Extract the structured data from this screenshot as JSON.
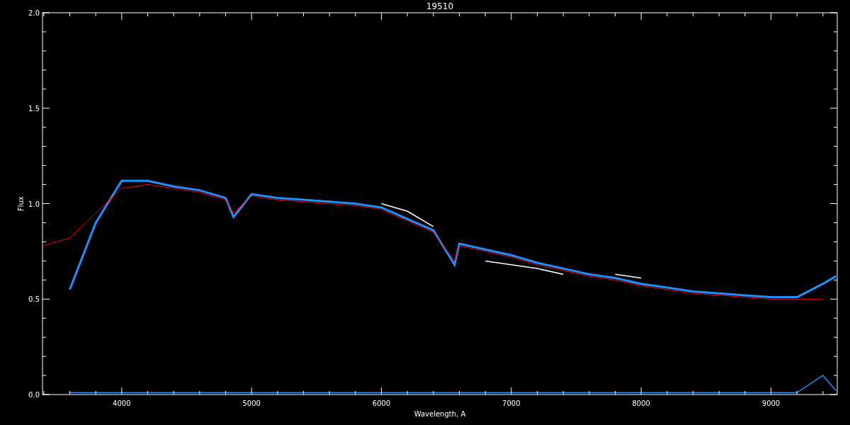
{
  "plot": {
    "chart_data": {
      "type": "line",
      "title": "19510",
      "xlabel": "Wavelength, A",
      "ylabel": "Flux",
      "x": [
        3400,
        3600,
        3800,
        4000,
        4200,
        4400,
        4600,
        4800,
        4861,
        5000,
        5200,
        5400,
        5600,
        5800,
        6000,
        6200,
        6400,
        6563,
        6600,
        6800,
        7000,
        7200,
        7400,
        7600,
        7800,
        8000,
        8200,
        8400,
        8600,
        8800,
        9000,
        9200,
        9400,
        9500
      ],
      "series": [
        {
          "color": "#ffffff",
          "values": [
            null,
            null,
            null,
            null,
            null,
            null,
            null,
            null,
            null,
            null,
            null,
            null,
            null,
            null,
            1.0,
            0.96,
            0.88,
            null,
            null,
            0.7,
            0.68,
            0.66,
            0.63,
            null,
            0.63,
            0.61,
            null,
            null,
            null,
            null,
            null,
            null,
            null,
            null
          ]
        },
        {
          "color": "#1e90ff",
          "values": [
            null,
            0.55,
            0.9,
            1.12,
            1.12,
            1.09,
            1.07,
            1.03,
            0.93,
            1.05,
            1.03,
            1.02,
            1.01,
            1.0,
            0.98,
            0.92,
            0.86,
            0.68,
            0.79,
            0.76,
            0.73,
            0.69,
            0.66,
            0.63,
            0.61,
            0.58,
            0.56,
            0.54,
            0.53,
            0.52,
            0.51,
            0.51,
            0.58,
            0.62
          ]
        },
        {
          "color": "#ff0000",
          "values": [
            0.78,
            0.82,
            0.95,
            1.08,
            1.1,
            1.08,
            1.06,
            1.02,
            0.95,
            1.04,
            1.02,
            1.01,
            1.0,
            0.99,
            0.97,
            0.91,
            0.85,
            0.7,
            0.78,
            0.75,
            0.72,
            0.68,
            0.65,
            0.62,
            0.6,
            0.57,
            0.55,
            0.53,
            0.52,
            0.51,
            0.5,
            0.5,
            0.5,
            null
          ]
        },
        {
          "color": "#1e90ff",
          "values": [
            null,
            0.01,
            0.01,
            0.01,
            0.01,
            0.01,
            0.01,
            0.01,
            0.01,
            0.01,
            0.01,
            0.01,
            0.01,
            0.01,
            0.01,
            0.01,
            0.01,
            0.01,
            0.01,
            0.01,
            0.01,
            0.01,
            0.01,
            0.01,
            0.01,
            0.01,
            0.01,
            0.01,
            0.01,
            0.01,
            0.01,
            0.01,
            0.1,
            0.02
          ]
        }
      ],
      "xlim": [
        3390,
        9510
      ],
      "ylim": [
        0,
        2
      ],
      "xticks": [
        4000,
        5000,
        6000,
        7000,
        8000,
        9000
      ],
      "yticks": [
        {
          "value": 0,
          "label": "0.0"
        },
        {
          "value": 0.5,
          "label": "0.5"
        },
        {
          "value": 1,
          "label": "1.0"
        },
        {
          "value": 1.5,
          "label": "1.5"
        },
        {
          "value": 2,
          "label": "2.0"
        }
      ]
    }
  }
}
